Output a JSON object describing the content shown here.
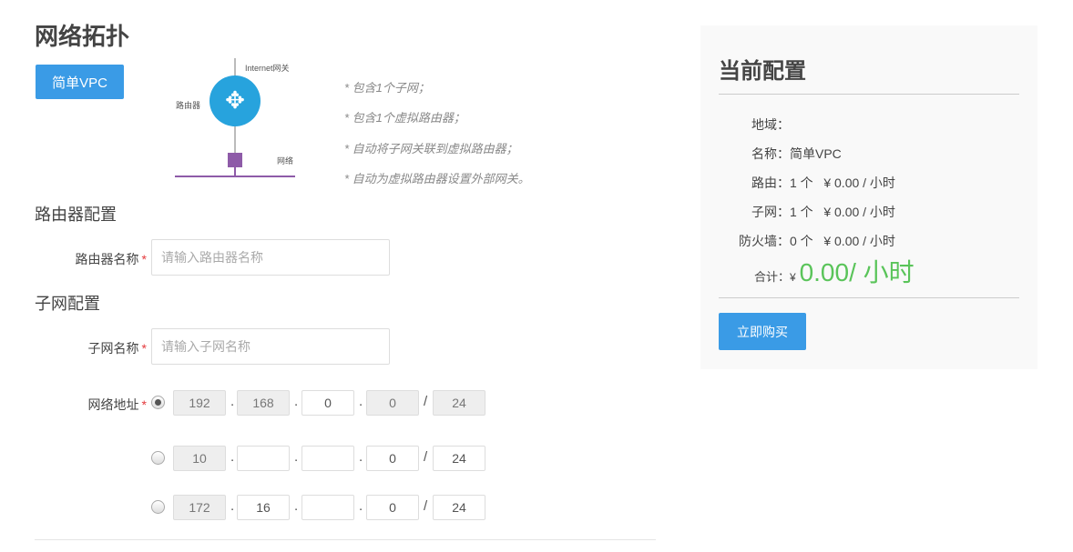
{
  "page_title": "网络拓扑",
  "vpc_button": "简单VPC",
  "diagram": {
    "internet_gateway": "Internet网关",
    "router": "路由器",
    "network": "网络"
  },
  "features": [
    "* 包含1个子网；",
    "* 包含1个虚拟路由器；",
    "* 自动将子网关联到虚拟路由器；",
    "* 自动为虚拟路由器设置外部网关。"
  ],
  "router_section": {
    "title": "路由器配置",
    "name_label": "路由器名称",
    "required": "*",
    "name_placeholder": "请输入路由器名称"
  },
  "subnet_section": {
    "title": "子网配置",
    "name_label": "子网名称",
    "required": "*",
    "name_placeholder": "请输入子网名称",
    "address_label": "网络地址"
  },
  "ip_rows": [
    {
      "selected": true,
      "octets": [
        {
          "v": "192",
          "d": true
        },
        {
          "v": "168",
          "d": true
        },
        {
          "v": "0",
          "d": false
        },
        {
          "v": "0",
          "d": true
        }
      ],
      "mask": {
        "v": "24",
        "d": true
      }
    },
    {
      "selected": false,
      "octets": [
        {
          "v": "10",
          "d": true
        },
        {
          "v": "",
          "d": false
        },
        {
          "v": "",
          "d": false
        },
        {
          "v": "0",
          "d": false
        }
      ],
      "mask": {
        "v": "24",
        "d": false
      }
    },
    {
      "selected": false,
      "octets": [
        {
          "v": "172",
          "d": true
        },
        {
          "v": "16",
          "d": false
        },
        {
          "v": "",
          "d": false
        },
        {
          "v": "0",
          "d": false
        }
      ],
      "mask": {
        "v": "24",
        "d": false
      }
    }
  ],
  "config": {
    "title": "当前配置",
    "rows": [
      {
        "k": "地域：",
        "v": ""
      },
      {
        "k": "名称：",
        "v": "简单VPC"
      },
      {
        "k": "路由：",
        "v": "1 个   ¥ 0.00 / 小时"
      },
      {
        "k": "子网：",
        "v": "1 个   ¥ 0.00 / 小时"
      },
      {
        "k": "防火墙：",
        "v": "0 个   ¥ 0.00 / 小时"
      }
    ],
    "total_label": "合计：",
    "currency": "¥",
    "total": "0.00/ 小时",
    "buy_button": "立即购买",
    "accent": "#5ac45a"
  }
}
